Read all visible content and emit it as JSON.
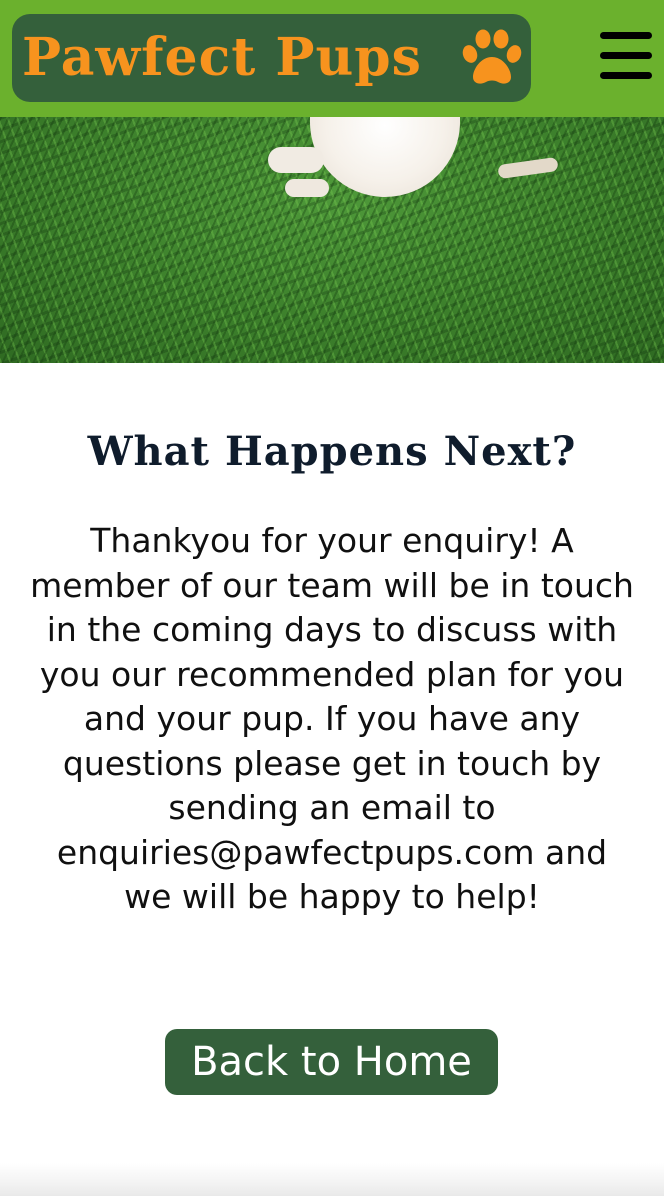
{
  "header": {
    "brand": "Pawfect Pups",
    "logo_icon": "paw-icon",
    "menu_icon": "hamburger-menu-icon",
    "background_color": "#6bb12d",
    "logo_background": "#34603b",
    "brand_color": "#f7931e"
  },
  "hero": {
    "image": "dog-on-grass"
  },
  "main": {
    "title": "What Happens Next?",
    "message": "Thankyou for your enquiry! A member of our team will be in touch in the coming days to discuss with you our recommended plan for you and your pup. If you have any questions please get in touch by sending an email to enquiries@pawfectpups.com and we will be happy to help!",
    "button_label": "Back to Home",
    "button_color": "#34603b"
  }
}
